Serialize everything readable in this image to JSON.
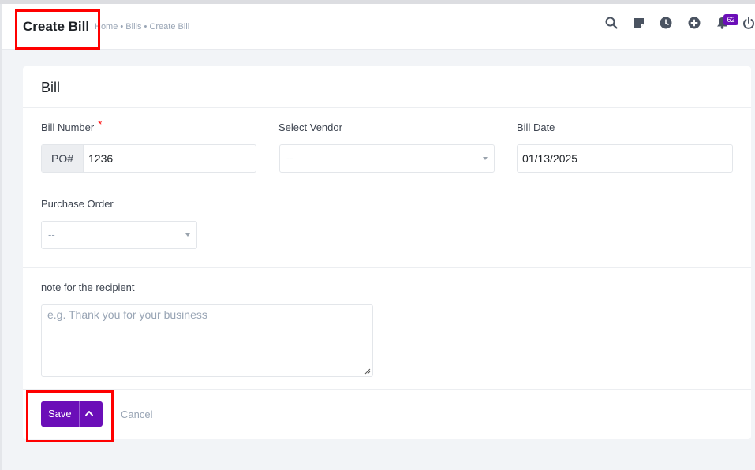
{
  "header": {
    "title": "Create Bill",
    "breadcrumb": "Home • Bills • Create Bill",
    "notification_count": "62",
    "icons": [
      "search-icon",
      "sticky-note-icon",
      "clock-icon",
      "add-circle-icon",
      "bell-icon",
      "power-icon"
    ]
  },
  "form": {
    "card_title": "Bill",
    "bill_number": {
      "label": "Bill Number",
      "required_mark": "*",
      "prefix": "PO#",
      "value": "1236"
    },
    "vendor": {
      "label": "Select Vendor",
      "value": "--"
    },
    "bill_date": {
      "label": "Bill Date",
      "value": "01/13/2025"
    },
    "purchase_order": {
      "label": "Purchase Order",
      "value": "--"
    },
    "note": {
      "label": "note for the recipient",
      "placeholder": "e.g. Thank you for your business"
    }
  },
  "actions": {
    "save_label": "Save",
    "cancel_label": "Cancel"
  },
  "colors": {
    "accent": "#6b0eb8",
    "highlight": "#ff0000"
  }
}
